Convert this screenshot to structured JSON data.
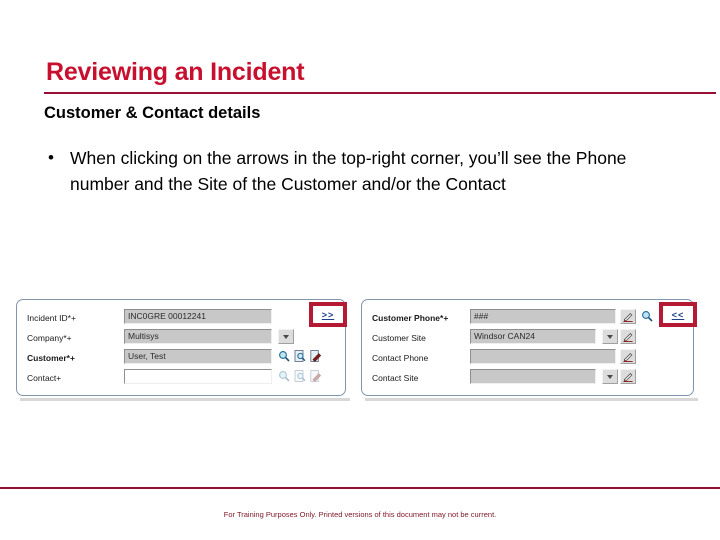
{
  "slide": {
    "title": "Reviewing an Incident",
    "subtitle": "Customer & Contact details",
    "title_color": "#c8102e",
    "rule_color": "#9c0d34",
    "bullets": [
      {
        "marker": "•",
        "text": "When clicking on the arrows in the top-right corner, you’ll see the Phone number and the Site of the Customer and/or the Contact"
      }
    ]
  },
  "screenshot": {
    "left_panel": {
      "rows": [
        {
          "label": "Incident ID*+",
          "label_bold": false,
          "value": "INC0GRE 00012241",
          "controls": [
            "callout-expand"
          ]
        },
        {
          "label": "Company*+",
          "label_bold": false,
          "value": "Multisys",
          "controls": [
            "dropdown"
          ]
        },
        {
          "label": "Customer*+",
          "label_bold": true,
          "value": "User, Test",
          "controls": [
            "search",
            "preview",
            "detail"
          ]
        },
        {
          "label": "Contact+",
          "label_bold": false,
          "value": "",
          "controls": [
            "search-dim",
            "preview-dim",
            "detail-dim"
          ]
        }
      ]
    },
    "right_panel": {
      "rows": [
        {
          "label": "Customer Phone*+",
          "label_bold": true,
          "value": "###",
          "controls": [
            "pencil",
            "search",
            "callout-collapse"
          ]
        },
        {
          "label": "Customer Site",
          "label_bold": false,
          "value": "Windsor  CAN24",
          "controls": [
            "dropdown",
            "pencil"
          ]
        },
        {
          "label": "Contact Phone",
          "label_bold": false,
          "value": "",
          "controls": [
            "pencil"
          ]
        },
        {
          "label": "Contact Site",
          "label_bold": false,
          "value": "",
          "controls": [
            "dropdown",
            "pencil"
          ]
        }
      ]
    },
    "callouts": {
      "expand_label": ">>",
      "collapse_label": "<<",
      "highlight_color": "#b51a35"
    }
  },
  "footer": {
    "text": "For Training Purposes Only. Printed versions of this document may not be current.",
    "color": "#7d1725"
  }
}
